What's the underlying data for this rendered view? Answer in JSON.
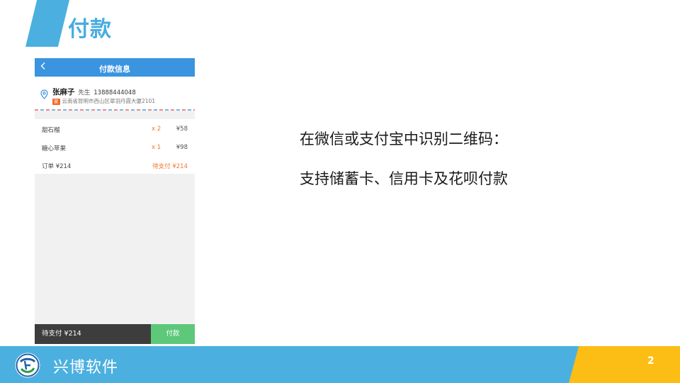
{
  "slide": {
    "title": "付款",
    "page_number": "2",
    "company_name": "兴博软件",
    "accent_color": "#4bb0e0",
    "yellow_color": "#fcbd15"
  },
  "phone": {
    "header_title": "付款信息",
    "back_icon": "chevron-left-icon",
    "address": {
      "icon": "location-pin-icon",
      "name": "张麻子",
      "title": "先生",
      "phone": "13888444048",
      "tag": "家",
      "detail": "云南省昆明市西山区翠羽丹霞大厦2101"
    },
    "items": [
      {
        "name": "甜石榴",
        "qty": "x 2",
        "price": "¥58"
      },
      {
        "name": "糖心苹果",
        "qty": "x 1",
        "price": "¥98"
      }
    ],
    "order": {
      "total_label": "订单 ¥214",
      "status": "待支付 ¥214"
    },
    "footer": {
      "amount": "待支付 ¥214",
      "pay_label": "付款"
    },
    "colors": {
      "header": "#3a94e0",
      "accent_orange": "#f07a2a",
      "pay_green": "#5dc77a",
      "footer_dark": "#3d3d3d"
    }
  },
  "info": {
    "line1": "在微信或支付宝中识别二维码：",
    "line2": "支持储蓄卡、信用卡及花呗付款"
  }
}
